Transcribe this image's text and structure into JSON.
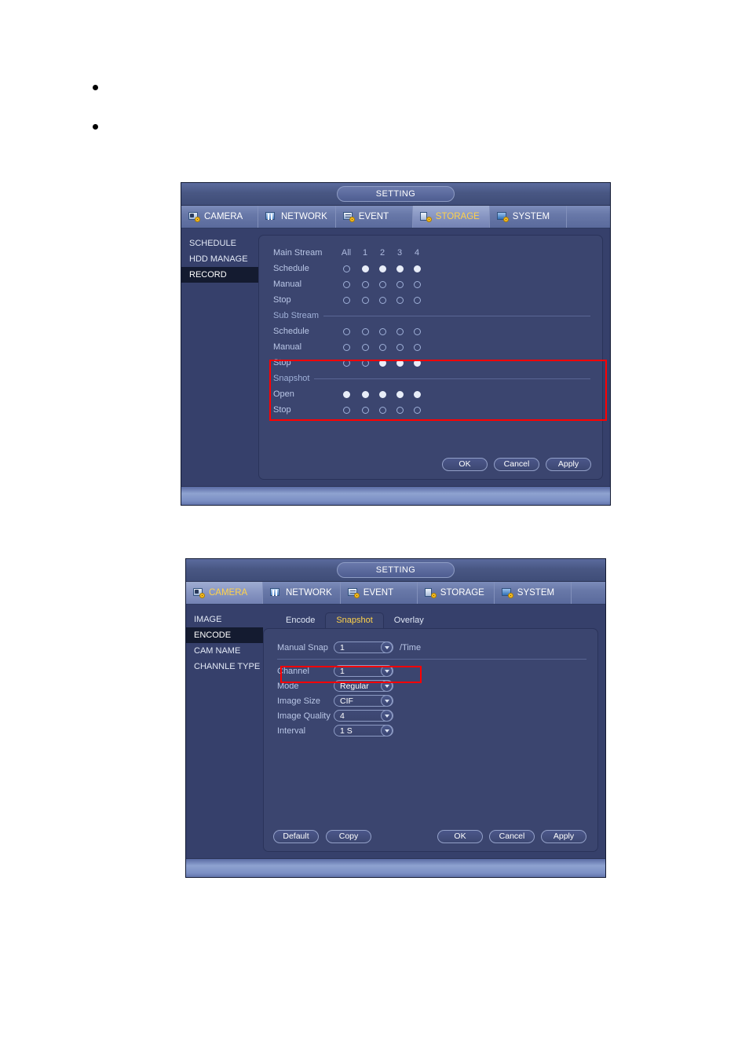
{
  "page": {
    "bullets": [
      {
        "text": ""
      },
      {
        "text": ""
      }
    ]
  },
  "colors": {
    "accent_yellow": "#ffd24a",
    "annotation_red": "#ff0000",
    "window_bg": "#36406b",
    "panel_bg": "#3b456f",
    "label_blue": "#b9c6e6"
  },
  "dialog1": {
    "title": "SETTING",
    "tabs": [
      {
        "label": "CAMERA",
        "icon": "camera-icon",
        "active": false
      },
      {
        "label": "NETWORK",
        "icon": "network-icon",
        "active": false
      },
      {
        "label": "EVENT",
        "icon": "event-icon",
        "active": false
      },
      {
        "label": "STORAGE",
        "icon": "storage-icon",
        "active": true
      },
      {
        "label": "SYSTEM",
        "icon": "system-icon",
        "active": false
      }
    ],
    "side_menu": [
      {
        "label": "SCHEDULE",
        "active": false
      },
      {
        "label": "HDD MANAGE",
        "active": false
      },
      {
        "label": "RECORD",
        "active": true
      }
    ],
    "record": {
      "header": {
        "label": "Main Stream",
        "all": "All",
        "channels": [
          "1",
          "2",
          "3",
          "4"
        ]
      },
      "main_stream_rows": [
        {
          "label": "Schedule",
          "all": false,
          "channels": [
            true,
            true,
            true,
            true
          ]
        },
        {
          "label": "Manual",
          "all": false,
          "channels": [
            false,
            false,
            false,
            false
          ]
        },
        {
          "label": "Stop",
          "all": false,
          "channels": [
            false,
            false,
            false,
            false
          ]
        }
      ],
      "sub_stream_title": "Sub Stream",
      "sub_stream_rows": [
        {
          "label": "Schedule",
          "all": false,
          "channels": [
            false,
            false,
            false,
            false
          ]
        },
        {
          "label": "Manual",
          "all": false,
          "channels": [
            false,
            false,
            false,
            false
          ]
        },
        {
          "label": "Stop",
          "all": false,
          "channels": [
            false,
            true,
            true,
            true
          ]
        }
      ],
      "snapshot_title": "Snapshot",
      "snapshot_rows": [
        {
          "label": "Open",
          "all": true,
          "channels": [
            true,
            true,
            true,
            true
          ]
        },
        {
          "label": "Stop",
          "all": false,
          "channels": [
            false,
            false,
            false,
            false
          ]
        }
      ]
    },
    "buttons": {
      "ok": "OK",
      "cancel": "Cancel",
      "apply": "Apply"
    }
  },
  "dialog2": {
    "title": "SETTING",
    "tabs": [
      {
        "label": "CAMERA",
        "icon": "camera-icon",
        "active": true
      },
      {
        "label": "NETWORK",
        "icon": "network-icon",
        "active": false
      },
      {
        "label": "EVENT",
        "icon": "event-icon",
        "active": false
      },
      {
        "label": "STORAGE",
        "icon": "storage-icon",
        "active": false
      },
      {
        "label": "SYSTEM",
        "icon": "system-icon",
        "active": false
      }
    ],
    "side_menu": [
      {
        "label": "IMAGE",
        "active": false
      },
      {
        "label": "ENCODE",
        "active": true
      },
      {
        "label": "CAM NAME",
        "active": false
      },
      {
        "label": "CHANNLE TYPE",
        "active": false
      }
    ],
    "sub_tabs": [
      {
        "label": "Encode",
        "active": false
      },
      {
        "label": "Snapshot",
        "active": true
      },
      {
        "label": "Overlay",
        "active": false
      }
    ],
    "form": {
      "manual_snap": {
        "label": "Manual Snap",
        "value": "1",
        "suffix": "/Time"
      },
      "channel": {
        "label": "Channel",
        "value": "1"
      },
      "mode": {
        "label": "Mode",
        "value": "Regular"
      },
      "image_size": {
        "label": "Image Size",
        "value": "CIF"
      },
      "image_quality": {
        "label": "Image Quality",
        "value": "4"
      },
      "interval": {
        "label": "Interval",
        "value": "1 S"
      }
    },
    "buttons": {
      "default": "Default",
      "copy": "Copy",
      "ok": "OK",
      "cancel": "Cancel",
      "apply": "Apply"
    }
  }
}
